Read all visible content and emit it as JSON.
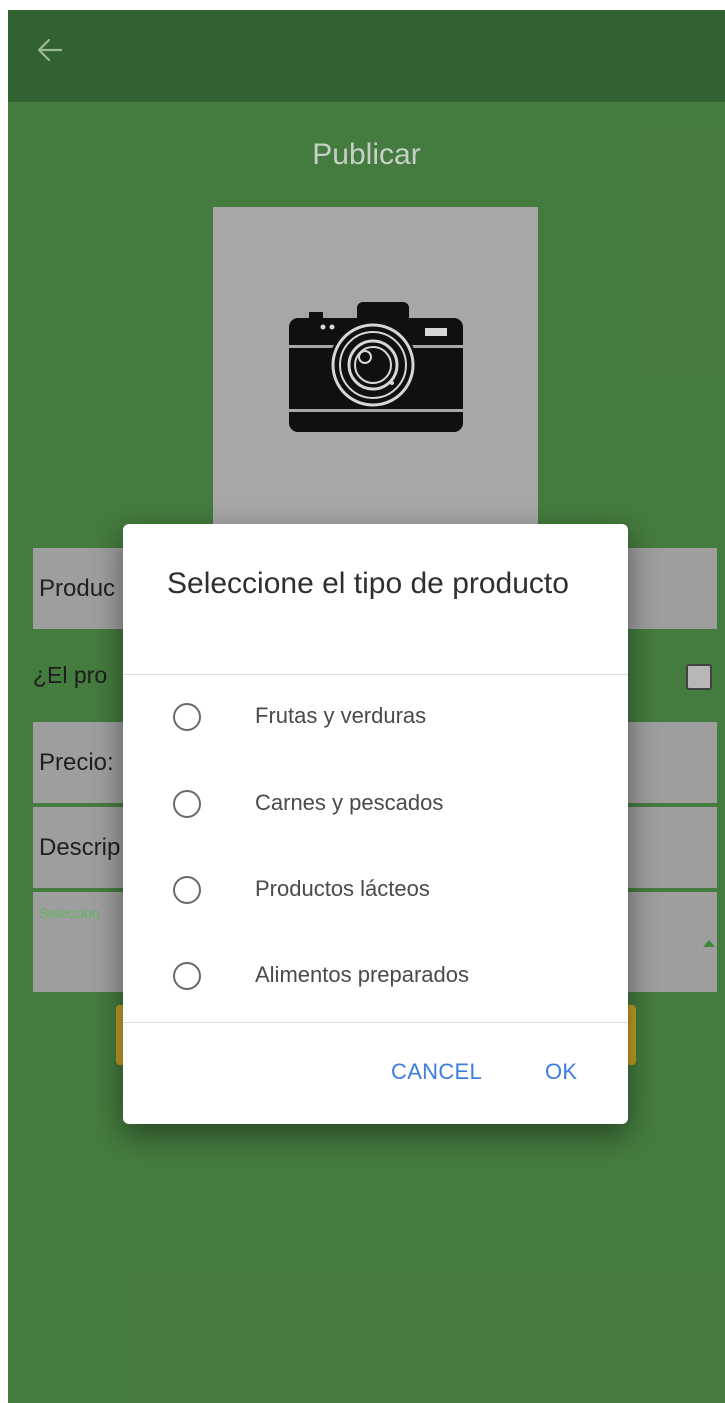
{
  "header": {
    "title": "Publicar"
  },
  "form": {
    "product_field_label": "Produc",
    "question_label": "¿El pro",
    "price_label": "Precio:",
    "description_label": "Descrip",
    "select_label": "Seleccion"
  },
  "dialog": {
    "title": "Seleccione el tipo de producto",
    "options": [
      {
        "label": "Frutas y verduras",
        "selected": false
      },
      {
        "label": "Carnes y pescados",
        "selected": false
      },
      {
        "label": "Productos lácteos",
        "selected": false
      },
      {
        "label": "Alimentos preparados",
        "selected": false
      }
    ],
    "cancel_label": "CANCEL",
    "ok_label": "OK"
  },
  "colors": {
    "background": "#477f41",
    "appbar": "#336632",
    "accent_button": "#3b7de3",
    "submit_button": "#c9a328"
  },
  "icons": {
    "back": "arrow-left-icon",
    "camera": "camera-icon",
    "dropdown": "triangle-up-icon"
  }
}
